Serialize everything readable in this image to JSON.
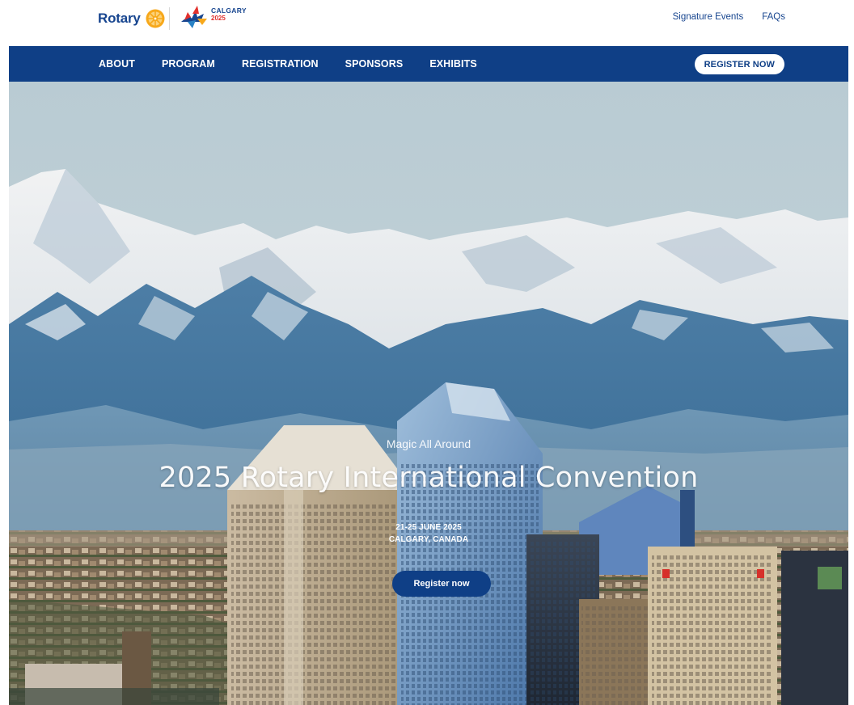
{
  "brand": {
    "rotary_wordmark": "Rotary",
    "calgary_name": "CALGARY",
    "calgary_year": "2025",
    "colors": {
      "rotary_blue": "#17458f",
      "nav_blue": "#0f3f86",
      "rotary_gold": "#f7a81b",
      "maple_red": "#e2312d"
    }
  },
  "utility_nav": {
    "links": [
      {
        "label": "Signature Events"
      },
      {
        "label": "FAQs"
      }
    ]
  },
  "main_nav": {
    "items": [
      {
        "label": "ABOUT"
      },
      {
        "label": "PROGRAM"
      },
      {
        "label": "REGISTRATION"
      },
      {
        "label": "SPONSORS"
      },
      {
        "label": "EXHIBITS"
      }
    ],
    "cta_label": "REGISTER NOW"
  },
  "hero": {
    "tagline": "Magic All Around",
    "title": "2025 Rotary International Convention",
    "dates": "21-25 JUNE 2025",
    "location": "CALGARY, CANADA",
    "cta_label": "Register now",
    "background_description_icon": "mountain-city-skyline"
  }
}
